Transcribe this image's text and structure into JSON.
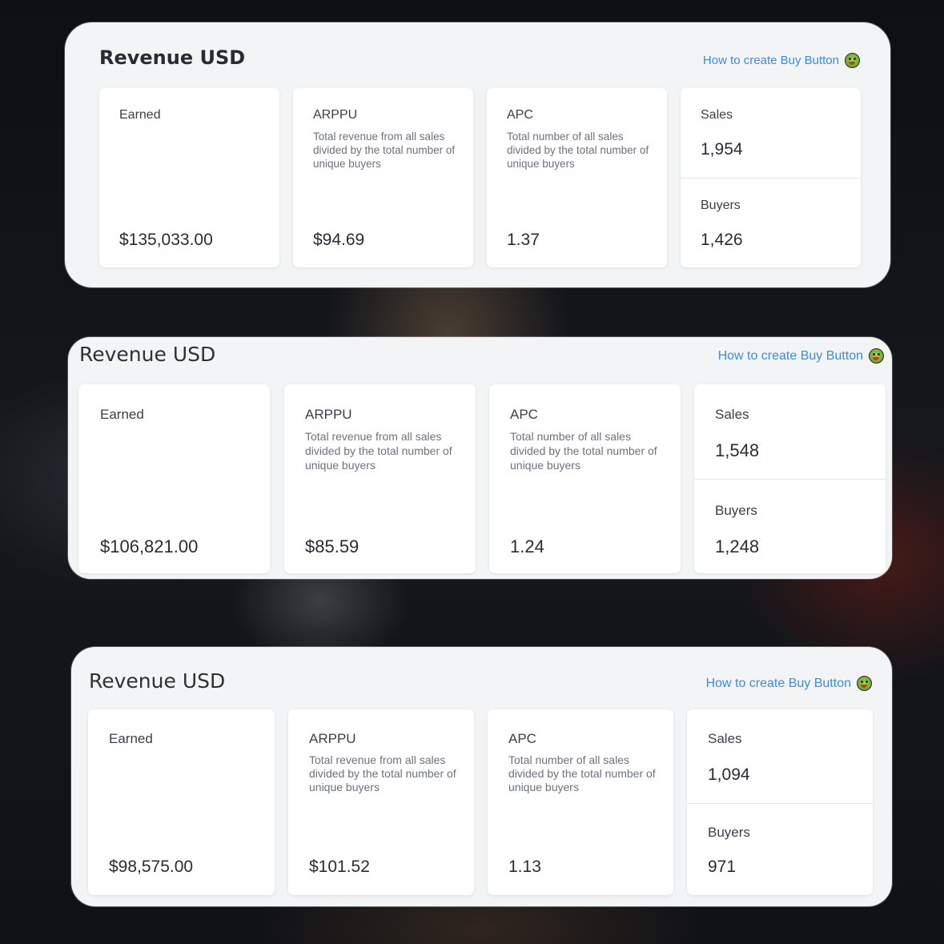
{
  "help_link_text": "How to create Buy Button",
  "help_icon": "tongue-out-face-emoji",
  "labels": {
    "earned": "Earned",
    "arppu": "ARPPU",
    "arppu_desc": "Total revenue from all sales divided by the total number of unique buyers",
    "apc": "APC",
    "apc_desc": "Total number of all sales divided by the total number of unique buyers",
    "sales": "Sales",
    "buyers": "Buyers"
  },
  "panels": [
    {
      "title": "Revenue USD",
      "earned": "$135,033.00",
      "arppu": "$94.69",
      "apc": "1.37",
      "sales": "1,954",
      "buyers": "1,426"
    },
    {
      "title": "Revenue USD",
      "earned": "$106,821.00",
      "arppu": "$85.59",
      "apc": "1.24",
      "sales": "1,548",
      "buyers": "1,248"
    },
    {
      "title": "Revenue USD",
      "earned": "$98,575.00",
      "arppu": "$101.52",
      "apc": "1.13",
      "sales": "1,094",
      "buyers": "971"
    }
  ],
  "colors": {
    "link": "#3d8be2",
    "panel_bg": "#f2f4f6",
    "card_bg": "#ffffff",
    "text_dark": "#272c36",
    "text_muted": "#6b7280"
  }
}
